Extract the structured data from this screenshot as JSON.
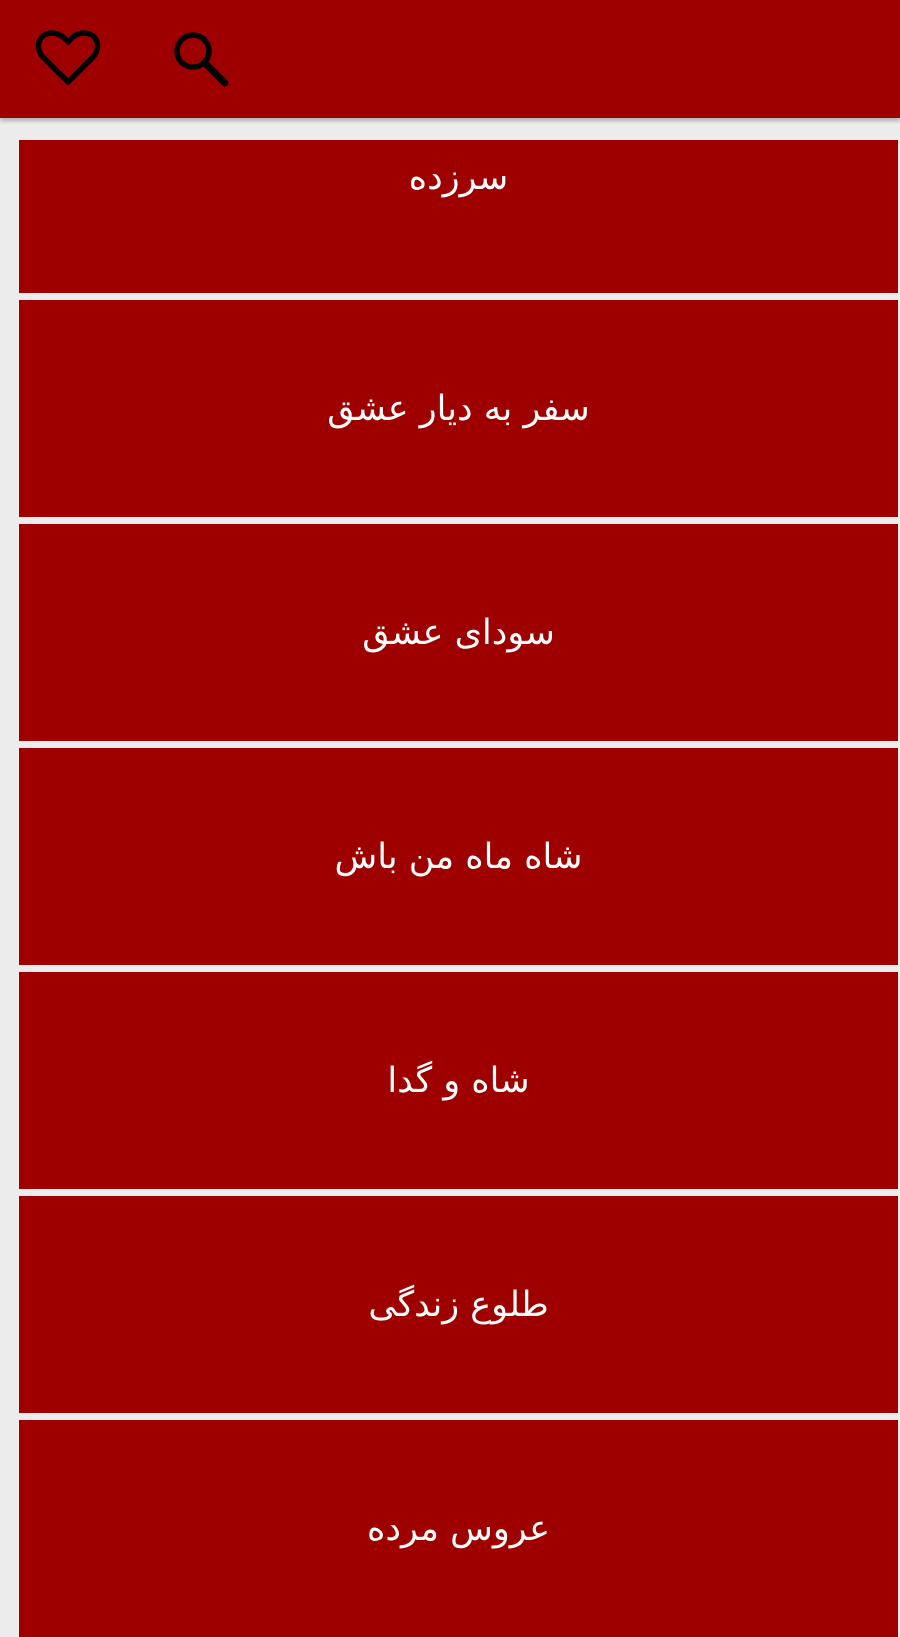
{
  "theme": {
    "primary": "#9e0000",
    "background": "#ececec",
    "text": "#ffffff",
    "icon": "#000000"
  },
  "app_bar": {
    "favorites_icon": "heart-outline-icon",
    "search_icon": "search-icon"
  },
  "list": {
    "items": [
      {
        "title": "سرزده"
      },
      {
        "title": "سفر به دیار عشق"
      },
      {
        "title": "سودای عشق"
      },
      {
        "title": "شاه ماه من باش"
      },
      {
        "title": "شاه و گدا"
      },
      {
        "title": "طلوع زندگی"
      },
      {
        "title": "عروس مرده"
      }
    ]
  }
}
